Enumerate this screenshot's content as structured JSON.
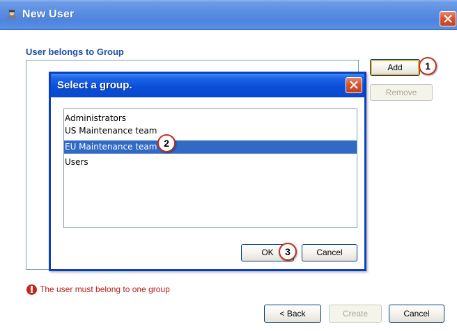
{
  "window": {
    "title": "New User",
    "section_label": "User belongs to Group",
    "add_label": "Add",
    "remove_label": "Remove",
    "error_text": "The user must belong to one group",
    "back_label": "< Back",
    "create_label": "Create",
    "cancel_label": "Cancel"
  },
  "dialog": {
    "title": "Select a group.",
    "items": [
      {
        "label": "Administrators",
        "selected": false
      },
      {
        "label": "US Maintenance team",
        "selected": false
      },
      {
        "label": "EU Maintenance team",
        "selected": true
      },
      {
        "label": "Users",
        "selected": false
      }
    ],
    "ok_label": "OK",
    "cancel_label": "Cancel"
  },
  "badges": [
    "1",
    "2",
    "3"
  ],
  "colors": {
    "title_bar": "#5b8ee3",
    "dialog_title_bar": "#0a4fd8",
    "selection": "#316ac5",
    "error": "#b4211a",
    "section_label": "#1e4fa3"
  }
}
